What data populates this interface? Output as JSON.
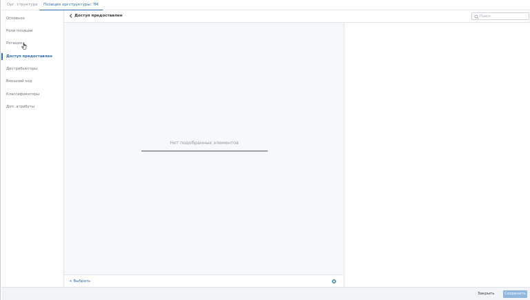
{
  "tabs": [
    {
      "label": "Орг. структура"
    },
    {
      "label": "Позиция оргструктуры: ТМ"
    }
  ],
  "sidebar": {
    "items": [
      {
        "label": "Основное"
      },
      {
        "label": "Роли позиции"
      },
      {
        "label": "Ротация"
      },
      {
        "label": "Доступ предоставлен"
      },
      {
        "label": "Дистрибьюторы"
      },
      {
        "label": "Внешний код"
      },
      {
        "label": "Классификаторы"
      },
      {
        "label": "Доп. атрибуты"
      }
    ]
  },
  "header": {
    "title": "Доступ предоставлен",
    "search_placeholder": "Поиск"
  },
  "main": {
    "empty_text": "Нет подобранных элементов",
    "select_label": "+ Выбрать"
  },
  "footer": {
    "close_label": "Закрыть",
    "save_label": "Сохранить"
  },
  "colors": {
    "accent": "#2b6cb0",
    "save_button": "#8fb6de"
  },
  "icons": [
    "back-arrow-icon",
    "search-icon",
    "gear-icon",
    "hand-cursor-icon"
  ]
}
